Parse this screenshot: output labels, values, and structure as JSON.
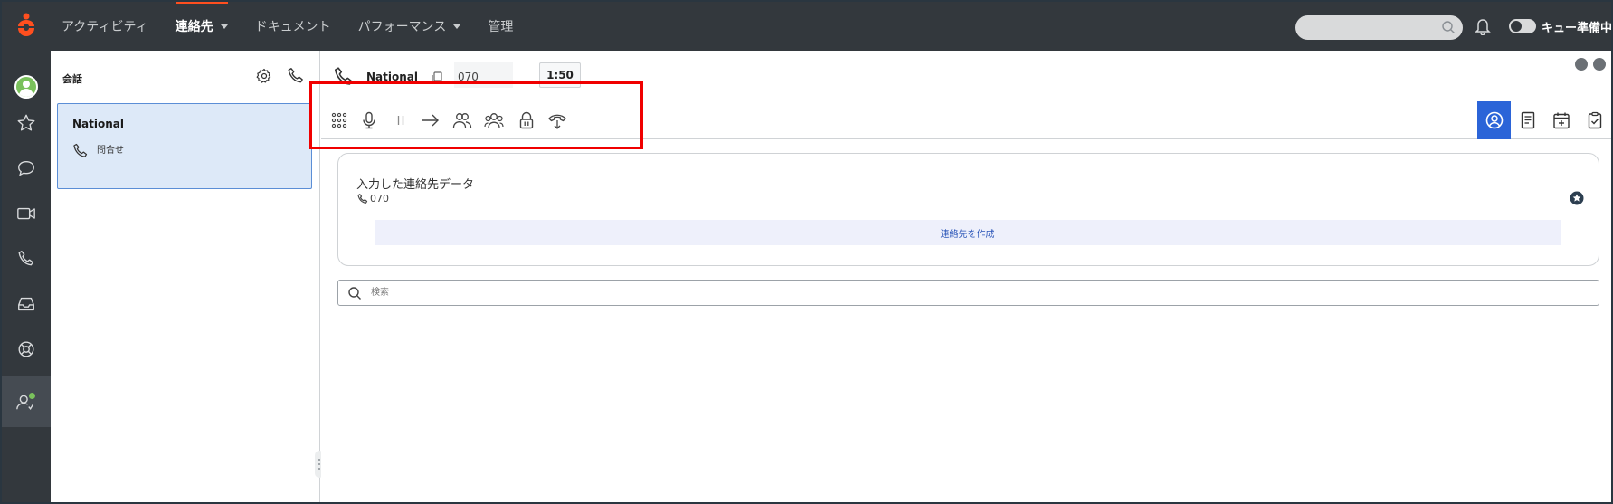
{
  "topbar": {
    "nav": [
      {
        "label": "アクティビティ",
        "active": false,
        "dropdown": false
      },
      {
        "label": "連絡先",
        "active": true,
        "dropdown": true
      },
      {
        "label": "ドキュメント",
        "active": false,
        "dropdown": false
      },
      {
        "label": "パフォーマンス",
        "active": false,
        "dropdown": true
      },
      {
        "label": "管理",
        "active": false,
        "dropdown": false
      }
    ],
    "queue_label": "キュー準備中"
  },
  "rail": {
    "items": [
      "avatar",
      "star-icon",
      "chat-icon",
      "video-icon",
      "phone-icon",
      "inbox-icon",
      "lifebuoy-icon",
      "agent-status-icon"
    ]
  },
  "conversations": {
    "title": "会話",
    "items": [
      {
        "name": "National",
        "subtitle": "問合せ"
      }
    ]
  },
  "call": {
    "name": "National",
    "number": "070",
    "timer": "1:50",
    "toolbar": [
      "dialpad-icon",
      "mic-icon",
      "pause-icon",
      "transfer-icon",
      "consult-icon",
      "conference-icon",
      "secure-pause-icon",
      "disconnect-icon"
    ]
  },
  "contact_card": {
    "title": "入力した連絡先データ",
    "number": "070",
    "create_label": "連絡先を作成"
  },
  "search": {
    "placeholder": "検索"
  },
  "colors": {
    "topbar": "#33383d",
    "accent_orange": "#ff4f1f",
    "highlight_red": "#f00000",
    "active_blue": "#2b64d8",
    "card_blue": "#dde9f8"
  }
}
